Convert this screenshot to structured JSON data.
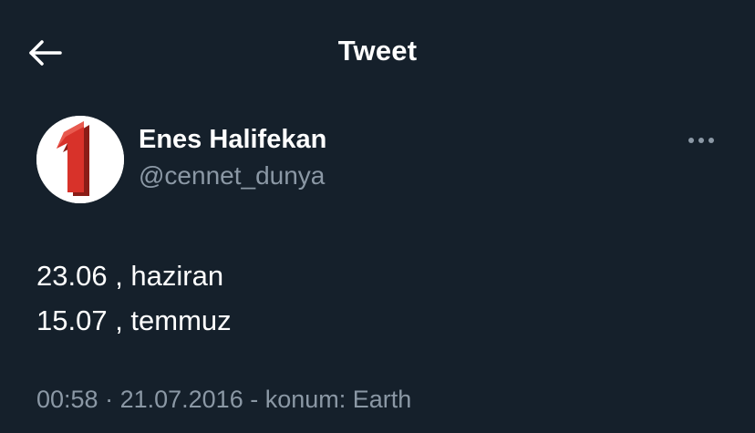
{
  "header": {
    "back_icon": "arrow-left-icon",
    "title": "Tweet"
  },
  "tweet": {
    "author": {
      "display_name": "Enes Halifekan",
      "username": "@cennet_dunya",
      "avatar_icon": "number-one-logo"
    },
    "more_icon": "ellipsis-icon",
    "lines": [
      "23.06 , haziran",
      "15.07 , temmuz"
    ],
    "time": "00:58",
    "separator": " · ",
    "date": "21.07.2016",
    "separator2": " - ",
    "location": "konum: Earth"
  },
  "colors": {
    "background": "#15202b",
    "primary_text": "#ffffff",
    "secondary_text": "#8b98a5",
    "avatar_red": "#d8322a"
  }
}
